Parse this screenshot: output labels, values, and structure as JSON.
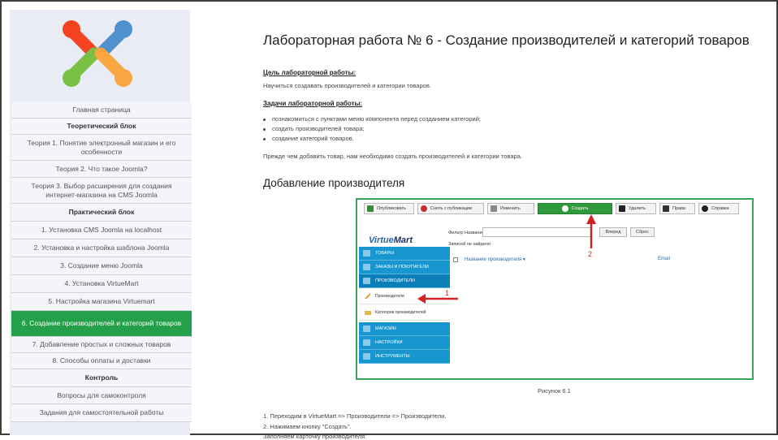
{
  "sidebar": {
    "items": [
      {
        "label": "Главная страница",
        "type": "link"
      },
      {
        "label": "Теоретический блок",
        "type": "header"
      },
      {
        "label": "Теория 1. Понятие электронный магазин и его особенности",
        "type": "link"
      },
      {
        "label": "Теория 2. Что такое Joomla?",
        "type": "link"
      },
      {
        "label": "Теория 3. Выбор расширения для создания интернет-магазина на CMS Joomla",
        "type": "link"
      },
      {
        "label": "Практический блок",
        "type": "header"
      },
      {
        "label": "1. Установка CMS Joomla на localhost",
        "type": "link"
      },
      {
        "label": "2. Установка и настройка шаблона Joomla",
        "type": "link"
      },
      {
        "label": "3. Создание меню Joomla",
        "type": "link"
      },
      {
        "label": "4. Установка VirtueMart",
        "type": "link"
      },
      {
        "label": "5. Настройка магазина Virtuemart",
        "type": "link"
      },
      {
        "label": "6. Создание производителей и категорий товаров",
        "type": "active"
      },
      {
        "label": "7. Добавление простых и сложных товаров",
        "type": "link"
      },
      {
        "label": "8. Способы оплаты и доставки",
        "type": "link"
      },
      {
        "label": "Контроль",
        "type": "header"
      },
      {
        "label": "Вопросы для самоконтроля",
        "type": "link"
      },
      {
        "label": "Задания для самостоятельной работы",
        "type": "link"
      }
    ]
  },
  "main": {
    "title": "Лабораторная работа № 6 - Создание производителей и категорий товаров",
    "goal_heading": "Цель лабораторной работы:",
    "goal_text": "Научиться создавать производителей и категории товаров.",
    "tasks_heading": "Задачи лабораторной работы:",
    "tasks": [
      "познакомиться с пунктами меню компонента перед созданием категорий;",
      "создать производителей товара;",
      "создание категорий товаров."
    ],
    "intro": "Прежде чем добавить товар, нам необходимо создать производителей и категории товара.",
    "section_title": "Добавление производителя",
    "figure_caption": "Рисунок 6.1",
    "steps": [
      "1. Переходим в VirtueMart => Производители => Производители.",
      "2. Нажимаем кнопку \"Создать\".",
      "Заполняем карточку производителя:"
    ]
  },
  "screenshot": {
    "toolbar": {
      "publish": "Опубликовать",
      "unpublish": "Снять с публикации",
      "edit": "Изменить",
      "create": "Создать",
      "delete": "Удалить",
      "rights": "Права",
      "help": "Справка"
    },
    "logo_a": "Virtue",
    "logo_b": "Mart",
    "filter_label": "Фильтр Название:",
    "filter_go": "Вперед",
    "filter_reset": "Сброс",
    "no_records": "Записей не найдено",
    "col_name": "Название производителя ▾",
    "col_email": "Email",
    "menu": {
      "products": "ТОВАРЫ",
      "orders": "ЗАКАЗЫ И ПОКУПАТЕЛИ",
      "manufacturers": "ПРОИЗВОДИТЕЛИ",
      "sub_manufacturers": "Производители",
      "sub_categories": "Категории производителей",
      "shop": "МАГАЗИН",
      "settings": "НАСТРОЙКИ",
      "tools": "ИНСТРУМЕНТЫ"
    },
    "marker_1": "1",
    "marker_2": "2",
    "colors": {
      "green": "#2f9a3c",
      "blue": "#1796cf",
      "arrow": "#d22222"
    }
  }
}
